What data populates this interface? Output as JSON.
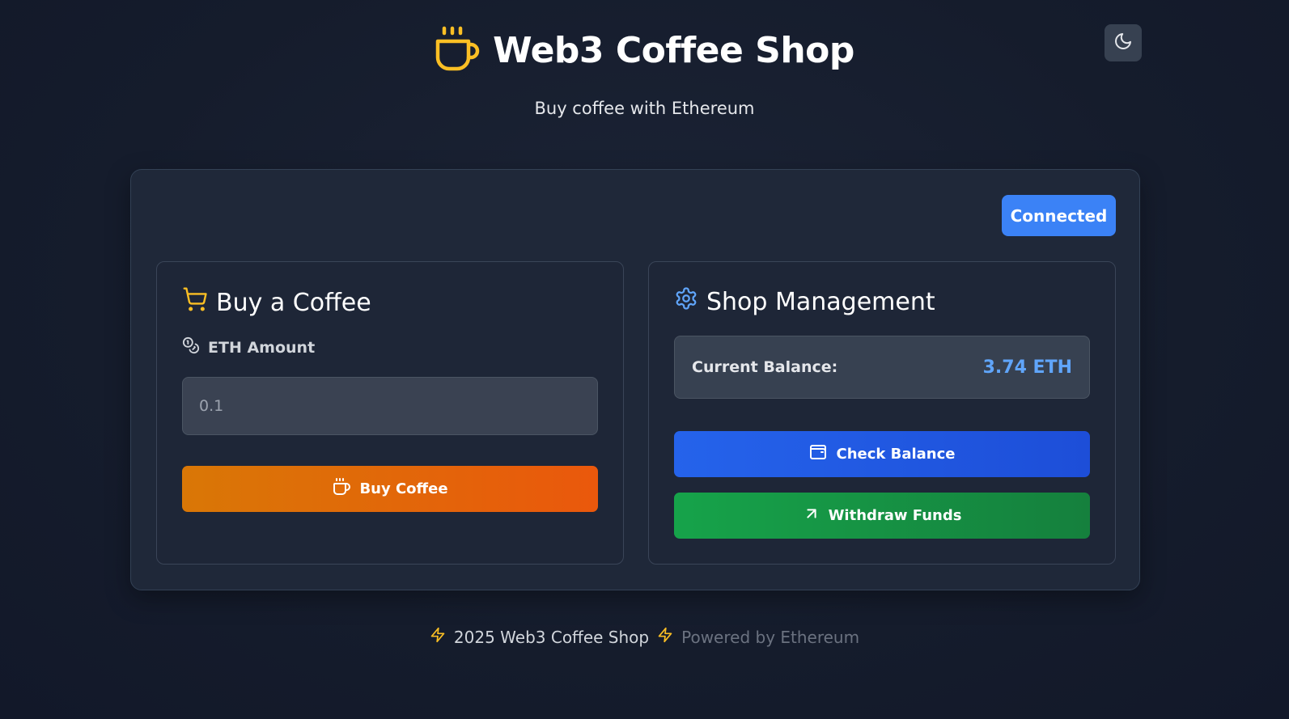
{
  "header": {
    "title": "Web3 Coffee Shop",
    "subtitle": "Buy coffee with Ethereum",
    "logo_icon": "coffee-cup-icon",
    "theme_toggle_icon": "moon-icon"
  },
  "wallet": {
    "status_label": "Connected"
  },
  "buy_panel": {
    "title": "Buy a Coffee",
    "title_icon": "shopping-cart-icon",
    "amount_label": "ETH Amount",
    "amount_icon": "coins-icon",
    "amount_value": "",
    "amount_placeholder": "0.1",
    "buy_button_label": "Buy Coffee",
    "buy_button_icon": "coffee-icon"
  },
  "management_panel": {
    "title": "Shop Management",
    "title_icon": "gear-icon",
    "balance_label": "Current Balance:",
    "balance_value": "3.74 ETH",
    "check_button_label": "Check Balance",
    "check_button_icon": "wallet-icon",
    "withdraw_button_label": "Withdraw Funds",
    "withdraw_button_icon": "arrow-up-right-icon"
  },
  "footer": {
    "copyright": "2025 Web3 Coffee Shop",
    "powered_by": "Powered by Ethereum",
    "icon": "lightning-icon"
  },
  "colors": {
    "accent_amber": "#fbbf24",
    "accent_blue": "#3b82f6",
    "balance_blue": "#60a5fa",
    "buy_orange": "#ea580c",
    "withdraw_green": "#16a34a",
    "check_blue": "#2563eb"
  }
}
